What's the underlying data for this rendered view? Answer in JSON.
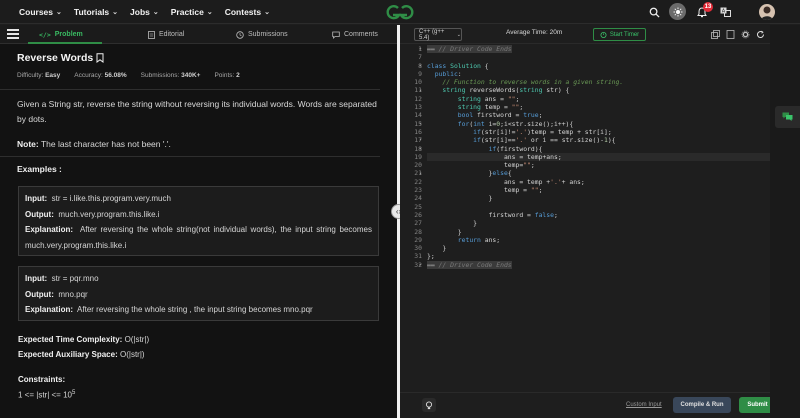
{
  "nav": {
    "menu": [
      "Courses",
      "Tutorials",
      "Jobs",
      "Practice",
      "Contests"
    ],
    "notification_count": "13",
    "accent": "#2f8d46"
  },
  "tabs": [
    {
      "label": "Problem",
      "icon": "code-icon"
    },
    {
      "label": "Editorial",
      "icon": "document-icon"
    },
    {
      "label": "Submissions",
      "icon": "clock-icon"
    },
    {
      "label": "Comments",
      "icon": "comment-icon"
    }
  ],
  "problem": {
    "title": "Reverse Words",
    "difficulty_label": "Difficulty:",
    "difficulty": "Easy",
    "accuracy_label": "Accuracy:",
    "accuracy": "56.08%",
    "submissions_label": "Submissions:",
    "submissions": "340K+",
    "points_label": "Points:",
    "points": "2",
    "description": "Given a String str, reverse the string without reversing its individual words. Words are separated by dots.",
    "note_label": "Note:",
    "note": "The last character has not been '.'.",
    "examples_label": "Examples :",
    "examples": [
      {
        "input": "str  =  i.like.this.program.very.much",
        "output": "much.very.program.this.like.i",
        "explanation": "After reversing the whole string(not individual words), the input string becomes much.very.program.this.like.i"
      },
      {
        "input": "str  =  pqr.mno",
        "output": "mno.pqr",
        "explanation": "After reversing the whole string , the input string becomes mno.pqr"
      }
    ],
    "input_label": "Input:",
    "output_label": "Output:",
    "explanation_label": "Explanation:",
    "time_label": "Expected Time Complexity:",
    "time": "O(|str|)",
    "space_label": "Expected Auxiliary Space:",
    "space": "O(|str|)",
    "constraints_label": "Constraints:",
    "constraint_base": "1 <= |str| <= 10",
    "constraint_exp": "5"
  },
  "editor": {
    "language": "C++ (g++ 5.4)",
    "avg_time": "Average Time: 20m",
    "timer_label": "Start Timer",
    "custom_input": "Custom Input",
    "compile_run": "Compile & Run",
    "submit": "Submit",
    "lines": [
      {
        "n": "1",
        "fold": "▸",
        "html": "<span class='cb'>▬▬ // Driver Code Ends</span>"
      },
      {
        "n": "7",
        "html": ""
      },
      {
        "n": "8",
        "fold": "▾",
        "html": "<span class='k'>class</span> <span class='t'>Solution</span> {"
      },
      {
        "n": "9",
        "html": "  <span class='k'>public</span>:"
      },
      {
        "n": "10",
        "html": "    <span class='c'>// Function to reverse words in a given string.</span>"
      },
      {
        "n": "11",
        "fold": "▾",
        "html": "    <span class='t'>string</span> reverseWords(<span class='t'>string</span> str) {"
      },
      {
        "n": "12",
        "html": "        <span class='t'>string</span> ans = <span class='s'>\"\"</span>;"
      },
      {
        "n": "13",
        "html": "        <span class='t'>string</span> temp = <span class='s'>\"\"</span>;"
      },
      {
        "n": "14",
        "html": "        <span class='k'>bool</span> firstword = <span class='k'>true</span>;"
      },
      {
        "n": "15",
        "fold": "▾",
        "html": "        <span class='k'>for</span>(<span class='k'>int</span> i=<span class='n'>0</span>;i&lt;str.size();i++){"
      },
      {
        "n": "16",
        "html": "            <span class='k'>if</span>(str[i]!=<span class='s'>'.'</span>)temp = temp + str[i];"
      },
      {
        "n": "17",
        "fold": "▾",
        "html": "            <span class='k'>if</span>(str[i]==<span class='s'>'.'</span> or i == str.size()-<span class='n'>1</span>){"
      },
      {
        "n": "18",
        "fold": "▾",
        "html": "                <span class='k'>if</span>(firstword){"
      },
      {
        "n": "19",
        "html": "                    ans = temp+ans;"
      },
      {
        "n": "20",
        "html": "                    temp=<span class='s'>\"\"</span>;"
      },
      {
        "n": "21",
        "fold": "▾",
        "html": "                }<span class='k'>else</span>{"
      },
      {
        "n": "22",
        "html": "                    ans = temp +<span class='s'>'.'</span>+ ans;"
      },
      {
        "n": "23",
        "html": "                    temp = <span class='s'>\"\"</span>;"
      },
      {
        "n": "24",
        "html": "                }"
      },
      {
        "n": "25",
        "html": ""
      },
      {
        "n": "26",
        "html": "                firstword = <span class='k'>false</span>;"
      },
      {
        "n": "27",
        "html": "            }"
      },
      {
        "n": "28",
        "html": "        }"
      },
      {
        "n": "29",
        "html": "        <span class='k'>return</span> ans;"
      },
      {
        "n": "30",
        "html": "    }"
      },
      {
        "n": "31",
        "html": "};"
      },
      {
        "n": "32",
        "fold": "▸",
        "html": "<span class='cb'>▬▬ // Driver Code Ends</span>"
      }
    ]
  }
}
